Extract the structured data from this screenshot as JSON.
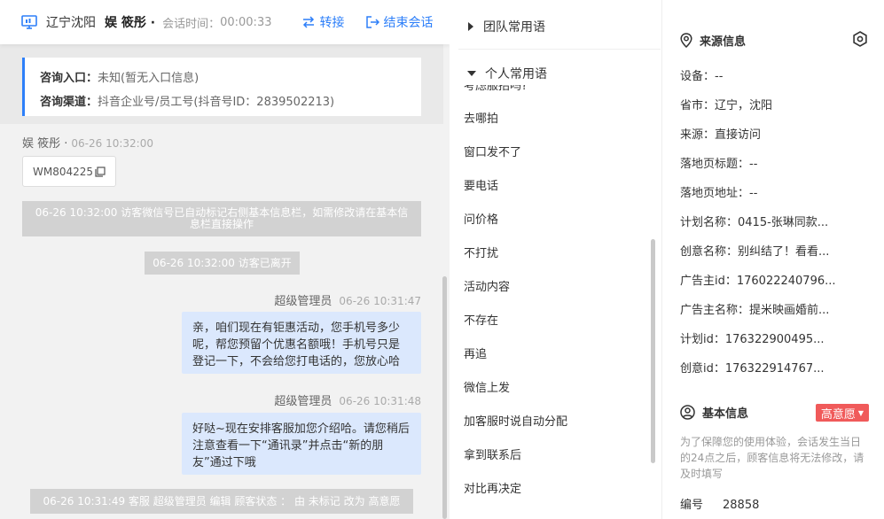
{
  "header": {
    "location": "辽宁沈阳",
    "user": "娱 筱彤 ·",
    "time_label": "会话时间：",
    "time_value": "00:00:33",
    "transfer_label": "转接",
    "end_label": "结束会话",
    "accent_color": "#2d7ff9"
  },
  "source_card": {
    "entry_key": "咨询入口：",
    "entry_value": "未知(暂无入口信息)",
    "channel_key": "咨询渠道：",
    "channel_value": "抖音企业号/员工号(抖音号ID：2839502213)"
  },
  "chat": {
    "visitor_name": "娱 筱彤 ·",
    "visitor_time": "06-26 10:32:00",
    "wm_id": "WM804225",
    "sys_msg_1": "06-26 10:32:00 访客微信号已自动标记右侧基本信息栏，如需修改请在基本信息栏直接操作",
    "sys_msg_2": "06-26 10:32:00 访客已离开",
    "agent1_name": "超级管理员",
    "agent1_time": "06-26 10:31:47",
    "agent1_text": "亲，咱们现在有钜惠活动，您手机号多少呢，帮您预留个优惠名额哦！手机号只是登记一下，不会给您打电话的，您放心哈",
    "agent2_name": "超级管理员",
    "agent2_time": "06-26 10:31:48",
    "agent2_text": "好哒~现在安排客服加您介绍哈。请您稍后注意查看一下“通讯录”并点击“新的朋友”通过下哦",
    "sys_msg_3": "06-26 10:31:49 客服 超级管理员 编辑 顾客状态 ： 由 未标记 改为 高意愿"
  },
  "phrases": {
    "team_group": "团队常用语",
    "personal_group": "个人常用语",
    "cut_item": "考虑服招吗?",
    "items": [
      "去哪拍",
      "窗口发不了",
      "要电话",
      "问价格",
      "不打扰",
      "活动内容",
      "不存在",
      "再追",
      "微信上发",
      "加客服时说自动分配",
      "拿到联系后",
      "对比再决定"
    ]
  },
  "info": {
    "source_title": "来源信息",
    "rows": [
      "设备：--",
      "省市：辽宁，沈阳",
      "来源：直接访问",
      "落地页标题：--",
      "落地页地址：--",
      "计划名称：0415-张琳同款...",
      "创意名称：别纠结了！看看...",
      "广告主id：176022240796...",
      "广告主名称：提米映画婚前...",
      "计划id：176322900495...",
      "创意id：176322914767..."
    ],
    "basic_title": "基本信息",
    "intent_label": "高意愿",
    "intent_color": "#f05a5a",
    "notice": "为了保障您的使用体验，会话发生当日的24点之后，顾客信息将无法修改，请及时填写",
    "id_label": "编号",
    "id_value": "28858"
  }
}
